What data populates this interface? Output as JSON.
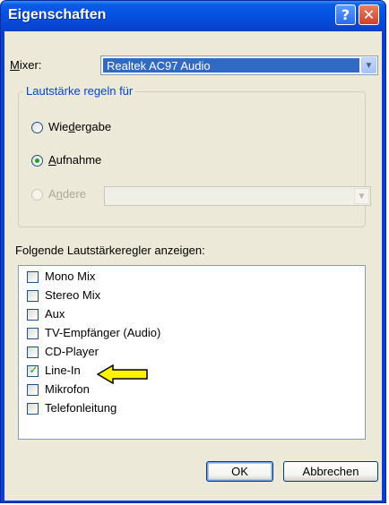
{
  "window": {
    "title": "Eigenschaften",
    "help_glyph": "?",
    "close_glyph": "✕"
  },
  "mixer": {
    "label_prefix": "M",
    "label_rest": "ixer:",
    "selected_value": "Realtek AC97 Audio",
    "dropdown_icon": "chevron-down-icon"
  },
  "volume_group": {
    "title": "Lautstärke regeln für",
    "options": [
      {
        "pre": "Wie",
        "ul": "d",
        "post": "ergabe",
        "selected": false,
        "enabled": true
      },
      {
        "pre": "",
        "ul": "A",
        "post": "ufnahme",
        "selected": true,
        "enabled": true
      },
      {
        "pre": "A",
        "ul": "n",
        "post": "dere",
        "selected": false,
        "enabled": false
      }
    ],
    "other_combo_value": ""
  },
  "controls": {
    "heading": "Folgende Lautstärkeregler anzeigen:",
    "items": [
      {
        "label": "Mono Mix",
        "checked": false
      },
      {
        "label": "Stereo Mix",
        "checked": false
      },
      {
        "label": "Aux",
        "checked": false
      },
      {
        "label": "TV-Empfänger (Audio)",
        "checked": false
      },
      {
        "label": "CD-Player",
        "checked": false
      },
      {
        "label": "Line-In",
        "checked": true
      },
      {
        "label": "Mikrofon",
        "checked": false
      },
      {
        "label": "Telefonleitung",
        "checked": false
      }
    ],
    "annotation": "yellow-arrow-pointing-at-line-in"
  },
  "buttons": {
    "ok": "OK",
    "cancel": "Abbrechen"
  },
  "colors": {
    "titlebar": "#0552e2",
    "selection": "#316ac5",
    "group_title": "#0046d5",
    "check": "#21a121",
    "arrow": "#fff200"
  }
}
